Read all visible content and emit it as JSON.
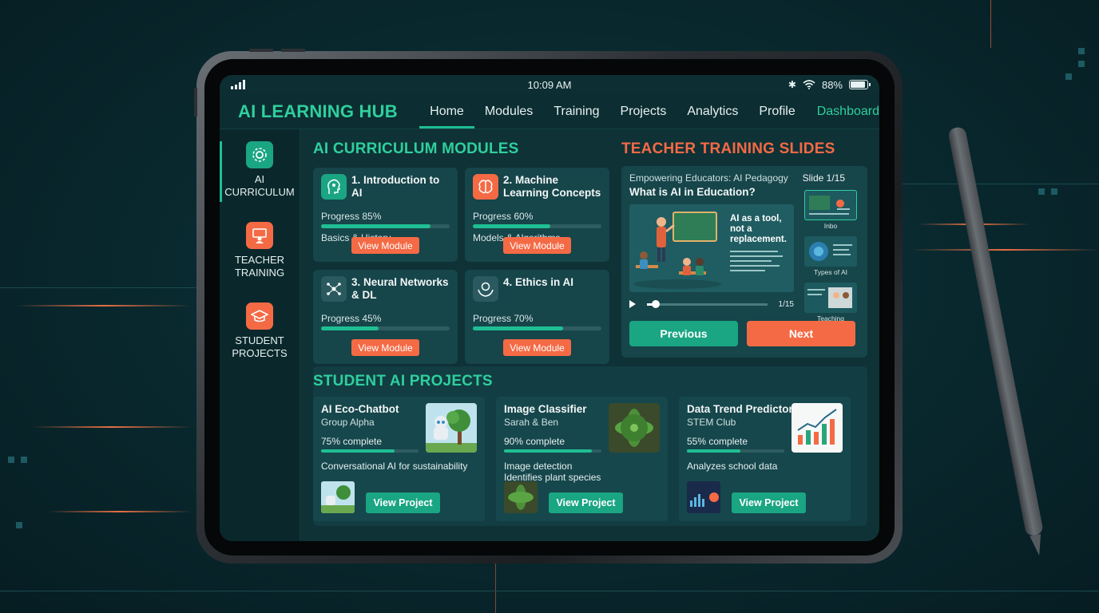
{
  "status": {
    "time": "10:09 AM",
    "battery": "88%",
    "battery_level": 0.88
  },
  "brand": "AI LEARNING HUB",
  "nav": {
    "items": [
      {
        "label": "Home",
        "active": true
      },
      {
        "label": "Modules"
      },
      {
        "label": "Training"
      },
      {
        "label": "Projects"
      },
      {
        "label": "Analytics"
      },
      {
        "label": "Profile"
      }
    ],
    "dashboard": "Dashboard"
  },
  "sidebar": {
    "items": [
      {
        "label_1": "AI",
        "label_2": "CURRICULUM",
        "icon": "gear-icon",
        "color": "#1aa583",
        "active": true
      },
      {
        "label_1": "TEACHER",
        "label_2": "TRAINING",
        "icon": "teacher-icon",
        "color": "#f46a45"
      },
      {
        "label_1": "STUDENT",
        "label_2": "PROJECTS",
        "icon": "graduation-cap-icon",
        "color": "#f46a45"
      }
    ]
  },
  "modules": {
    "title": "AI CURRICULUM MODULES",
    "items": [
      {
        "title": "1. Introduction to AI",
        "progress_label": "Progress 85%",
        "progress": 0.85,
        "subtitle": "Basics & History",
        "button": "View Module",
        "icon": "head-circuit-icon",
        "icon_color": "#1aa583"
      },
      {
        "title": "2. Machine Learning Concepts",
        "progress_label": "Progress 60%",
        "progress": 0.6,
        "subtitle": "Models & Algorithms",
        "button": "View Module",
        "icon": "brain-icon",
        "icon_color": "#f46a45"
      },
      {
        "title": "3. Neural Networks & DL",
        "progress_label": "Progress 45%",
        "progress": 0.45,
        "subtitle": "",
        "button": "View Module",
        "icon": "neural-network-icon",
        "icon_color": "#2a5a60"
      },
      {
        "title": "4. Ethics in AI",
        "progress_label": "Progress 70%",
        "progress": 0.7,
        "subtitle": "",
        "button": "View Module",
        "icon": "hands-brain-icon",
        "icon_color": "#2a5a60"
      }
    ]
  },
  "training": {
    "title": "TEACHER TRAINING SLIDES",
    "subtitle": "Empowering Educators: AI Pedagogy",
    "slide_label": "Slide 1/15",
    "question": "What is AI in Education?",
    "caption": "AI as a tool, not a replacement.",
    "player_count": "1/15",
    "player_progress": 0.07,
    "thumbs": [
      {
        "label": "Inbo"
      },
      {
        "label": "Types of AI"
      },
      {
        "label": "Teaching Strategies"
      }
    ],
    "prev": "Previous",
    "next": "Next"
  },
  "projects": {
    "title": "STUDENT AI PROJECTS",
    "items": [
      {
        "title": "AI Eco-Chatbot",
        "team": "Group Alpha",
        "pct_label": "75% complete",
        "progress": 0.75,
        "desc_1": "Conversational AI for sustainability",
        "desc_2": "",
        "button": "View Project"
      },
      {
        "title": "Image Classifier",
        "team": "Sarah & Ben",
        "pct_label": "90% complete",
        "progress": 0.9,
        "desc_1": "Image detection",
        "desc_2": "Identifies plant species",
        "button": "View Project"
      },
      {
        "title": "Data Trend Predictor",
        "team": "STEM Club",
        "pct_label": "55% complete",
        "progress": 0.55,
        "desc_1": "Analyzes school data",
        "desc_2": "",
        "button": "View Project"
      }
    ]
  }
}
